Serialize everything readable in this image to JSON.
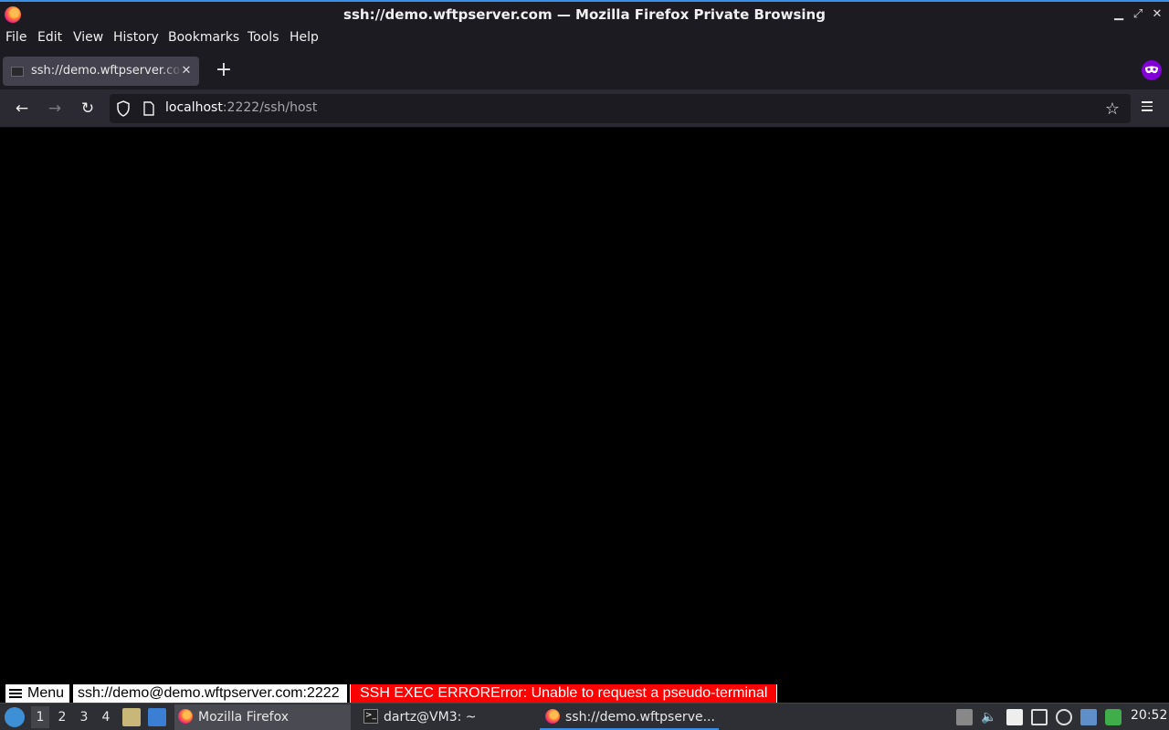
{
  "window": {
    "title": "ssh://demo.wftpserver.com — Mozilla Firefox Private Browsing"
  },
  "menubar": {
    "items": [
      "File",
      "Edit",
      "View",
      "History",
      "Bookmarks",
      "Tools",
      "Help"
    ]
  },
  "tab": {
    "label": "ssh://demo.wftpserver.com",
    "close": "✕"
  },
  "newtab": {
    "label": "+"
  },
  "nav": {
    "back": "←",
    "forward": "→",
    "reload": "↻",
    "url_host": "localhost",
    "url_rest": ":2222/ssh/host",
    "bookmark": "☆"
  },
  "terminal_status": {
    "menu_label": "Menu",
    "host": "ssh://demo@demo.wftpserver.com:2222",
    "error": "SSH EXEC ERRORError: Unable to request a pseudo-terminal",
    "error_color": "#ff0000"
  },
  "taskbar": {
    "workspaces": [
      "1",
      "2",
      "3",
      "4"
    ],
    "tasks": [
      {
        "label": "Mozilla Firefox"
      },
      {
        "label": "dartz@VM3: ~"
      },
      {
        "label": "ssh://demo.wftpserve..."
      }
    ],
    "clock": "20:52"
  },
  "colors": {
    "accent": "#3a8ee6",
    "private": "#8000d7",
    "chrome_dark": "#1c1b22"
  }
}
